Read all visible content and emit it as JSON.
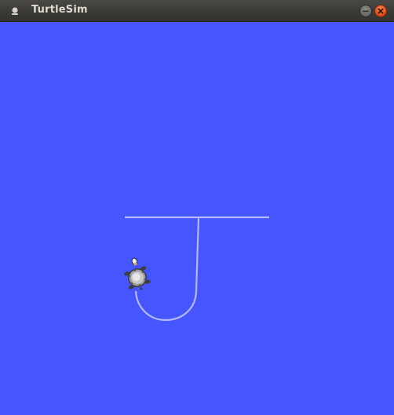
{
  "window": {
    "title": "TurtleSim"
  },
  "icons": {
    "app": "turtle-app-icon",
    "minimize": "minimize-icon",
    "close": "close-icon"
  },
  "colors": {
    "background": "#4556ff",
    "pen": "#b3b8ff",
    "titlebar": "#3c3b37",
    "title_text": "#dfdbd2",
    "close_button": "#dd4814"
  }
}
